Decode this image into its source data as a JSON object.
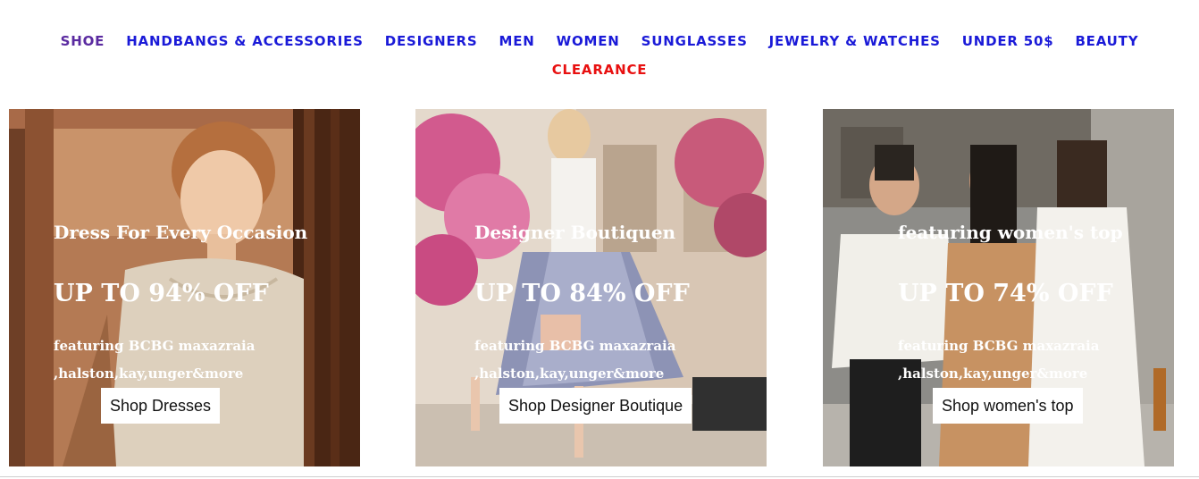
{
  "nav": {
    "items": [
      {
        "label": "SHOE"
      },
      {
        "label": "HANDBANGS & ACCESSORIES"
      },
      {
        "label": "DESIGNERS"
      },
      {
        "label": "MEN"
      },
      {
        "label": "WOMEN"
      },
      {
        "label": "SUNGLASSES"
      },
      {
        "label": "JEWELRY & WATCHES"
      },
      {
        "label": "UNDER 50$"
      },
      {
        "label": "BEAUTY"
      }
    ],
    "clearance": "CLEARANCE",
    "colors": {
      "link": "#1a1ad8",
      "visited": "#5a2aa0",
      "sale": "#e81010"
    }
  },
  "cards": [
    {
      "heading": "Dress For Every Occasion",
      "discount": "UP TO 94% OFF",
      "sub": "featuring BCBG maxazraia ,halston,kay,unger&more",
      "button": "Shop Dresses"
    },
    {
      "heading": "Designer Boutiquen",
      "discount": "UP TO 84% OFF",
      "sub": "featuring BCBG maxazraia ,halston,kay,unger&more",
      "button": "Shop Designer Boutique"
    },
    {
      "heading": "featuring women's top",
      "discount": "UP TO 74% OFF",
      "sub": "featuring BCBG maxazraia ,halston,kay,unger&more",
      "button": "Shop women's top"
    }
  ]
}
